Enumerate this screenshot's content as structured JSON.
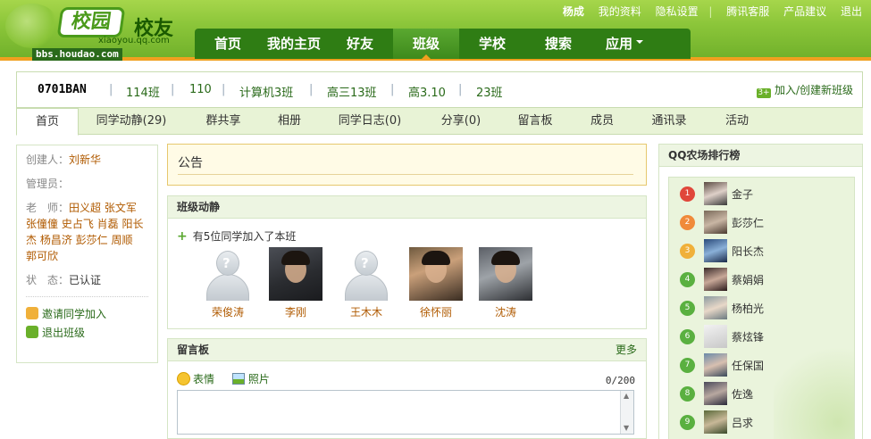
{
  "header": {
    "logo_mark": "校园",
    "logo_title": "校友",
    "logo_domain": "xiaoyou.qq.com",
    "logo_bbs": "bbs.houdao.com",
    "user": "杨成",
    "links": [
      "我的资料",
      "隐私设置",
      "腾讯客服",
      "产品建议",
      "退出"
    ],
    "nav": [
      "首页",
      "我的主页",
      "好友",
      "班级",
      "学校",
      "搜索",
      "应用"
    ]
  },
  "classbar": {
    "current": "0701BAN",
    "classes": [
      "114班",
      "110",
      "计算机3班",
      "高三13班",
      "高3.10",
      "23班"
    ],
    "join_label": "加入/创建新班级"
  },
  "subtabs": [
    "首页",
    "同学动静(29)",
    "群共享",
    "相册",
    "同学日志(0)",
    "分享(0)",
    "留言板",
    "成员",
    "通讯录",
    "活动"
  ],
  "info": {
    "creator_label": "创建人：",
    "creator": "刘新华",
    "admin_label": "管理员：",
    "teacher_label": "老　师：",
    "teachers_line1": "田义超 张文军",
    "teachers_line2": "张僮僮 史占飞 肖磊 阳长",
    "teachers_line3": "杰 杨昌济 彭莎仁 周顺",
    "teachers_line4": "郭可欣",
    "status_label": "状　态：",
    "status": "已认证",
    "invite": "邀请同学加入",
    "leave": "退出班级"
  },
  "notice": {
    "title": "公告"
  },
  "news": {
    "title": "班级动静",
    "text": "有5位同学加入了本班",
    "members": [
      "荣俊涛",
      "李刚",
      "王木木",
      "徐怀丽",
      "沈涛"
    ]
  },
  "board": {
    "title": "留言板",
    "more": "更多",
    "emoji": "表情",
    "photo": "照片",
    "counter": "0/200"
  },
  "ranking": {
    "title": "QQ农场排行榜",
    "items": [
      {
        "rank": "1",
        "name": "金子",
        "color": "#e0473a"
      },
      {
        "rank": "2",
        "name": "彭莎仁",
        "color": "#f08a3a"
      },
      {
        "rank": "3",
        "name": "阳长杰",
        "color": "#f0b03a"
      },
      {
        "rank": "4",
        "name": "蔡娟娟",
        "color": "#5ab040"
      },
      {
        "rank": "5",
        "name": "杨柏光",
        "color": "#5ab040"
      },
      {
        "rank": "6",
        "name": "蔡炫锋",
        "color": "#5ab040"
      },
      {
        "rank": "7",
        "name": "任保国",
        "color": "#5ab040"
      },
      {
        "rank": "8",
        "name": "佐逸",
        "color": "#5ab040"
      },
      {
        "rank": "9",
        "name": "吕求",
        "color": "#5ab040"
      }
    ]
  }
}
